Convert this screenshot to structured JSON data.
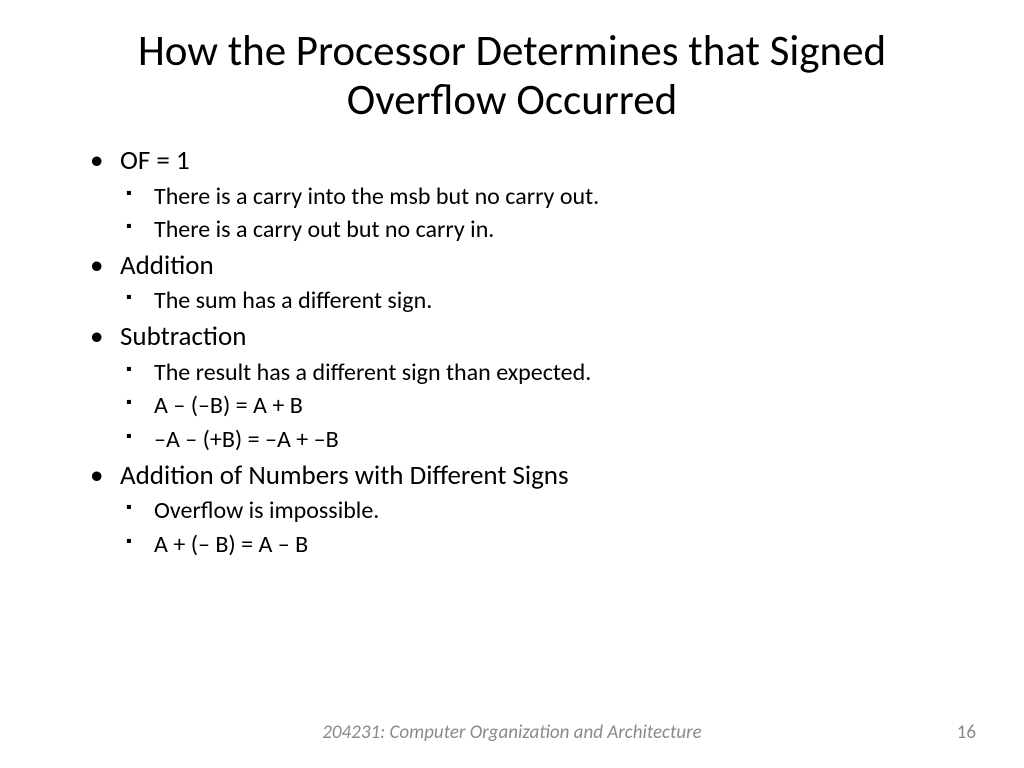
{
  "title": "How the Processor Determines that Signed Overflow Occurred",
  "bullets": [
    {
      "label": "OF = 1",
      "sub": [
        "There is a carry into the msb but no carry out.",
        "There is a carry out but no carry in."
      ]
    },
    {
      "label": "Addition",
      "sub": [
        "The sum has a different sign."
      ]
    },
    {
      "label": "Subtraction",
      "sub": [
        "The result has a different sign than expected.",
        "A – (–B) = A + B",
        "–A – (+B) = –A + –B"
      ]
    },
    {
      "label": "Addition of Numbers with Different Signs",
      "sub": [
        "Overflow is impossible.",
        "A + (– B) = A – B"
      ]
    }
  ],
  "footer": {
    "course": "204231: Computer Organization and Architecture",
    "page": "16"
  }
}
